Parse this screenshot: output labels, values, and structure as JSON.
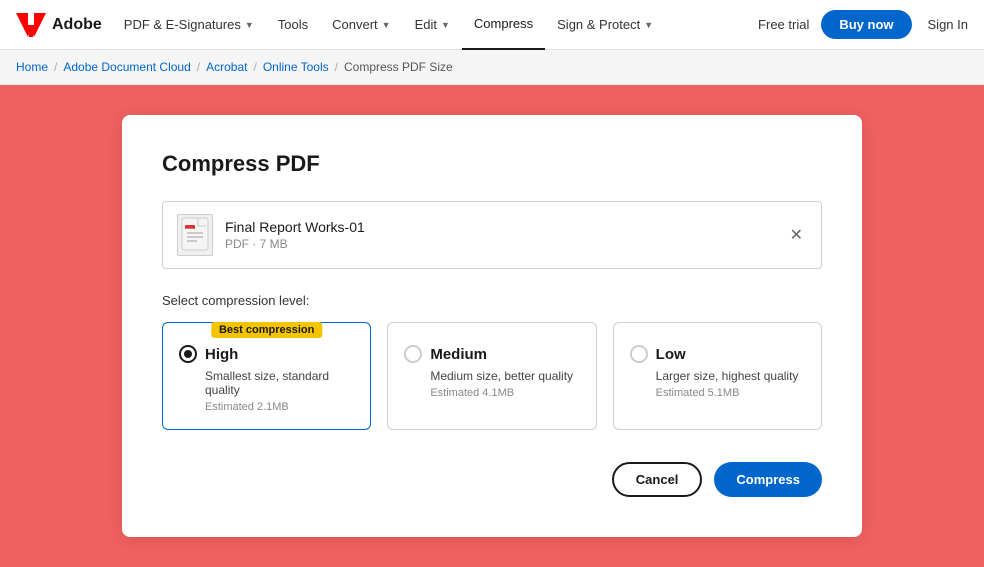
{
  "nav": {
    "logo_text": "Adobe",
    "items": [
      {
        "label": "PDF & E-Signatures",
        "has_chevron": true,
        "active": false
      },
      {
        "label": "Tools",
        "has_chevron": false,
        "active": false
      },
      {
        "label": "Convert",
        "has_chevron": true,
        "active": false
      },
      {
        "label": "Edit",
        "has_chevron": true,
        "active": false
      },
      {
        "label": "Compress",
        "has_chevron": false,
        "active": true
      },
      {
        "label": "Sign & Protect",
        "has_chevron": true,
        "active": false
      }
    ],
    "free_trial": "Free trial",
    "buy_now": "Buy now",
    "sign_in": "Sign In"
  },
  "breadcrumb": {
    "items": [
      {
        "label": "Home",
        "link": true
      },
      {
        "label": "Adobe Document Cloud",
        "link": true
      },
      {
        "label": "Acrobat",
        "link": true
      },
      {
        "label": "Online Tools",
        "link": true
      },
      {
        "label": "Compress PDF Size",
        "link": false
      }
    ]
  },
  "card": {
    "title": "Compress PDF",
    "file": {
      "name": "Final Report Works-01",
      "meta": "PDF · 7 MB"
    },
    "compression_label": "Select compression level:",
    "options": [
      {
        "id": "high",
        "title": "High",
        "description": "Smallest size, standard quality",
        "estimated": "Estimated 2.1MB",
        "badge": "Best compression",
        "selected": true
      },
      {
        "id": "medium",
        "title": "Medium",
        "description": "Medium size, better quality",
        "estimated": "Estimated 4.1MB",
        "badge": null,
        "selected": false
      },
      {
        "id": "low",
        "title": "Low",
        "description": "Larger size, highest quality",
        "estimated": "Estimated 5.1MB",
        "badge": null,
        "selected": false
      }
    ],
    "cancel_label": "Cancel",
    "compress_label": "Compress"
  }
}
